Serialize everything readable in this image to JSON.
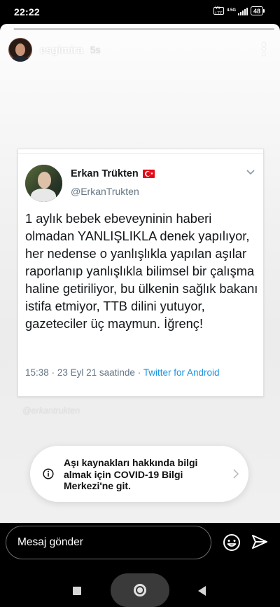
{
  "status_bar": {
    "time": "22:22",
    "volte_top": "Vo",
    "volte_bottom": "LTE",
    "network": "4.5G",
    "battery": "48"
  },
  "story": {
    "username": "esgimira",
    "time_ago": "5s"
  },
  "tweet": {
    "author_name": "Erkan Trükten",
    "author_handle": "@ErkanTrukten",
    "flag": "turkey-flag",
    "text": "1 aylık bebek ebeveyninin haberi olmadan YANLIŞLIKLA denek yapılıyor, her nedense o yanlışlıkla yapılan aşılar raporlanıp yanlışlıkla bilimsel bir çalışma haline getiriliyor, bu ülkenin sağlık bakanı istifa etmiyor, TTB dilini yutuyor, gazeteciler üç maymun. İğrenç!",
    "time": "15:38",
    "date": "23 Eyl 21",
    "date_suffix": "saatinde",
    "separator": "·",
    "source": "Twitter for Android"
  },
  "watermark": "@erkantrukten",
  "info_banner": {
    "text": "Aşı kaynakları hakkında bilgi almak için COVID-19 Bilgi Merkezi'ne git."
  },
  "message_bar": {
    "placeholder": "Mesaj gönder"
  },
  "colors": {
    "link_blue": "#1b95e0",
    "flag_red": "#e30a17"
  }
}
